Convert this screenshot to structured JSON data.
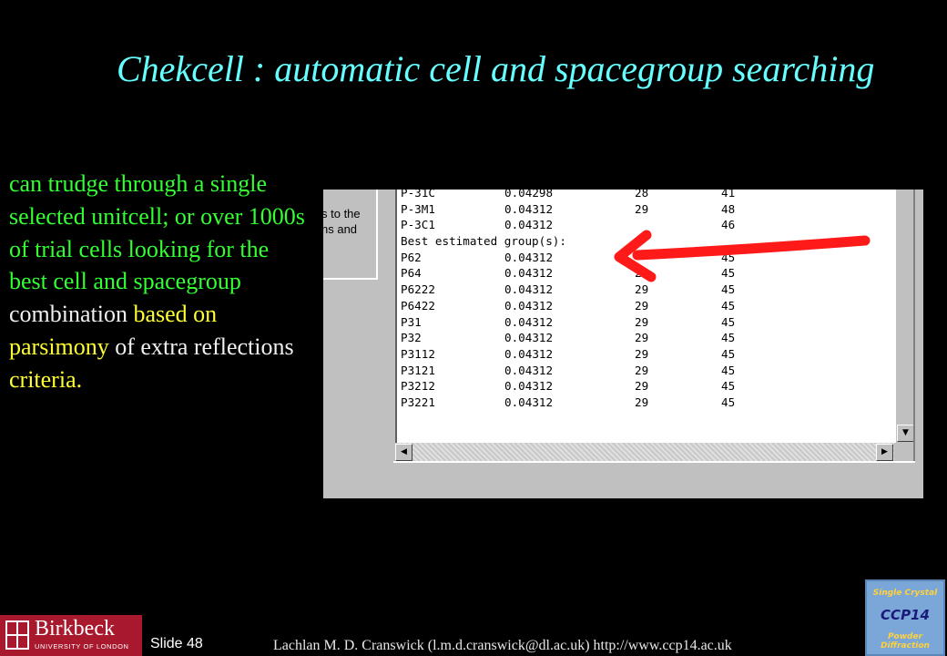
{
  "slide": {
    "title": "Chekcell  : automatic cell and spacegroup searching",
    "body": {
      "part1": "can trudge through a single selected unitcell; or over 1000s of trial cells looking for the best cell and spacegroup",
      "part2": "combination",
      "part3": "based on parsimony",
      "part4": "of extra reflections",
      "part5": "criteria."
    },
    "slide_number": "Slide 48",
    "footer": "Lachlan M. D. Cranswick (l.m.d.cranswick@dl.ac.uk) http://www.ccp14.ac.uk",
    "logo_left": {
      "name": "Birkbeck",
      "subtitle": "UNIVERSITY OF LONDON"
    },
    "logo_right": {
      "line1": "Single Crystal",
      "line2": "CCP14",
      "line3": "Powder Diffraction"
    },
    "colors": {
      "title": "#66ffff",
      "green": "#33ff33",
      "yellow": "#ffff33",
      "arrow": "#ff1a1a",
      "birkbeck": "#a8192e"
    }
  },
  "screenshot": {
    "left_fragment": [
      "s to the",
      "ns and"
    ],
    "rows": [
      [
        "P-31C",
        "0.04298",
        "28",
        "41"
      ],
      [
        "P-3M1",
        "0.04312",
        "29",
        "48"
      ],
      [
        "P-3C1",
        "0.04312",
        "",
        "46"
      ],
      [
        "Best estimated group(s):",
        "",
        "",
        ""
      ],
      [
        "P62",
        "0.04312",
        "",
        "45"
      ],
      [
        "P64",
        "0.04312",
        "29",
        "45"
      ],
      [
        "P6222",
        "0.04312",
        "29",
        "45"
      ],
      [
        "P6422",
        "0.04312",
        "29",
        "45"
      ],
      [
        "P31",
        "0.04312",
        "29",
        "45"
      ],
      [
        "P32",
        "0.04312",
        "29",
        "45"
      ],
      [
        "P3112",
        "0.04312",
        "29",
        "45"
      ],
      [
        "P3121",
        "0.04312",
        "29",
        "45"
      ],
      [
        "P3212",
        "0.04312",
        "29",
        "45"
      ],
      [
        "P3221",
        "0.04312",
        "29",
        "45"
      ]
    ],
    "scroll_icons": {
      "down": "▼",
      "left": "◀",
      "right": "▶"
    }
  }
}
